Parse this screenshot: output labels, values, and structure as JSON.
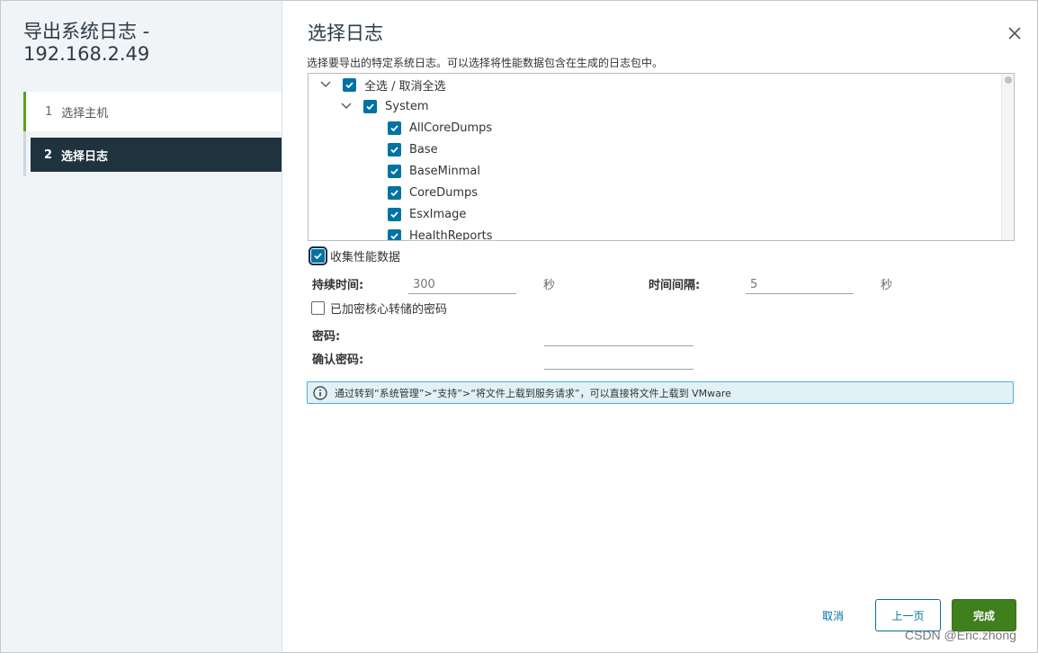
{
  "wizard": {
    "title": "导出系统日志 - 192.168.2.49"
  },
  "steps": [
    {
      "number": "1",
      "label": "选择主机"
    },
    {
      "number": "2",
      "label": "选择日志"
    }
  ],
  "main": {
    "title": "选择日志",
    "subtitle": "选择要导出的特定系统日志。可以选择将性能数据包含在生成的日志包中。"
  },
  "tree": {
    "root_label": "全选 / 取消全选",
    "group_label": "System",
    "items": [
      "AllCoreDumps",
      "Base",
      "BaseMinmal",
      "CoreDumps",
      "EsxImage",
      "HealthReports"
    ]
  },
  "options": {
    "collect_perf_label": "收集性能数据",
    "collect_perf_checked": true,
    "duration_label": "持续时间:",
    "duration_value": "300",
    "duration_unit": "秒",
    "interval_label": "时间间隔:",
    "interval_value": "5",
    "interval_unit": "秒",
    "encrypt_label": "已加密核心转储的密码",
    "encrypt_checked": false,
    "password_label": "密码:",
    "confirm_password_label": "确认密码:"
  },
  "info": {
    "text": "通过转到“系统管理”>“支持”>“将文件上载到服务请求”，可以直接将文件上载到 VMware"
  },
  "footer": {
    "cancel_label": "取消",
    "back_label": "上一页",
    "finish_label": "完成"
  },
  "watermark": "CSDN @Eric.zhong",
  "colors": {
    "primary": "#0072a3",
    "success": "#3f7f1c",
    "sidebar_active": "#1f333f",
    "info_border": "#49afd9"
  }
}
